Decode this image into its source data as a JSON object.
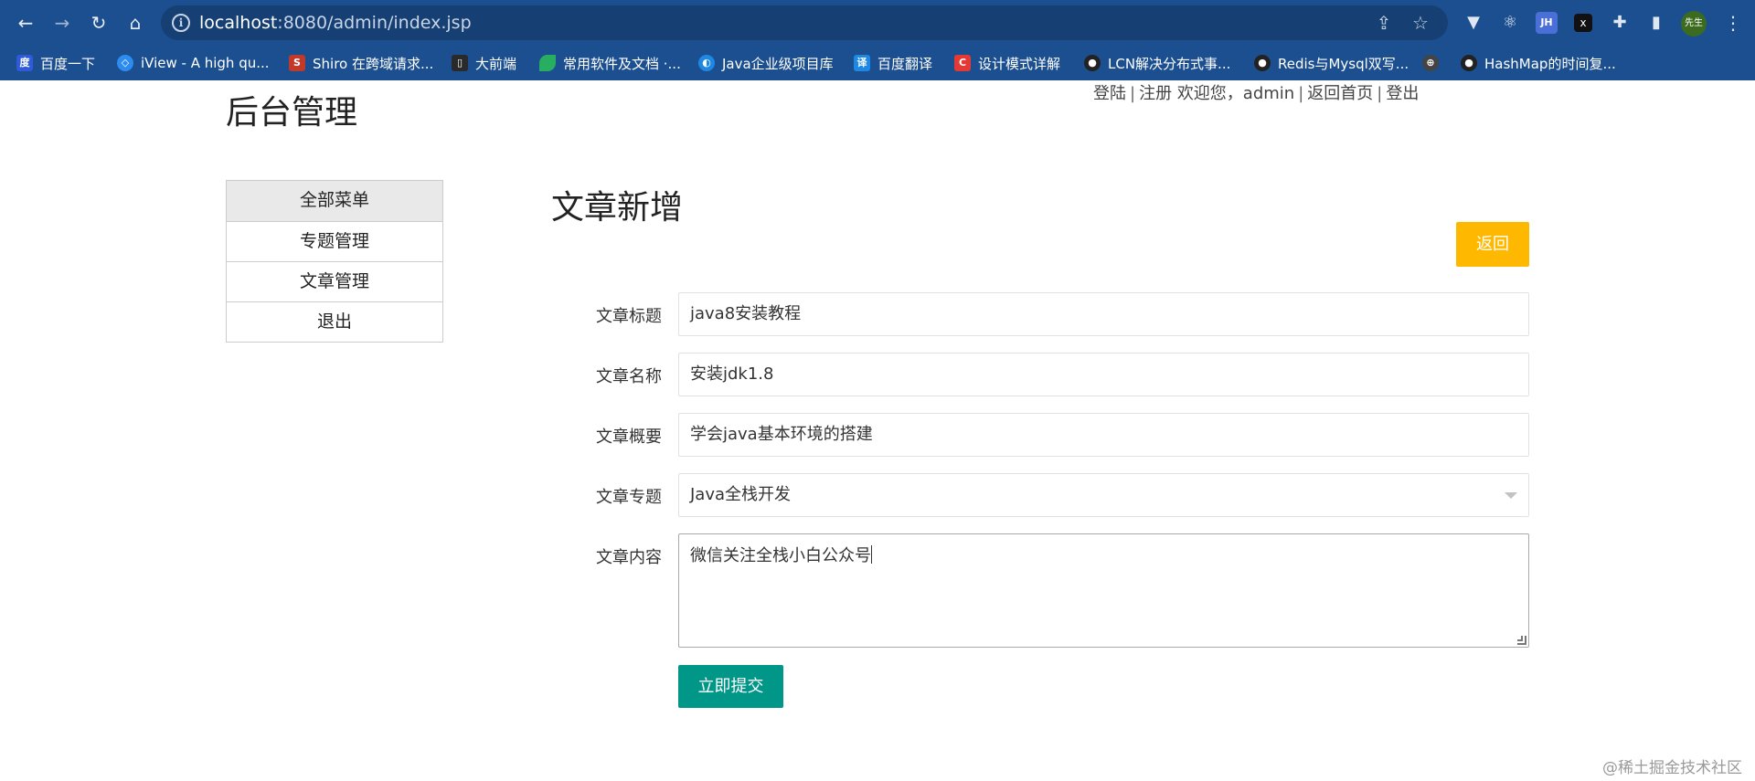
{
  "browser": {
    "url_host": "localhost",
    "url_path": ":8080/admin/index.jsp",
    "profile_label": "先生",
    "bookmarks": [
      {
        "label": "百度一下",
        "icon": "baidu-paw-icon",
        "color": "#2f5bd9"
      },
      {
        "label": "iView - A high qu...",
        "icon": "iview-icon",
        "color": "#2d8cf0"
      },
      {
        "label": "Shiro 在跨域请求...",
        "icon": "shiro-icon",
        "color": "#c0392b"
      },
      {
        "label": "大前端",
        "icon": "book-icon",
        "color": "#2a2a2a"
      },
      {
        "label": "常用软件及文档 ·...",
        "icon": "leaf-icon",
        "color": "#27ae60"
      },
      {
        "label": "Java企业级项目库",
        "icon": "java-lib-icon",
        "color": "#1e88e5"
      },
      {
        "label": "百度翻译",
        "icon": "translate-icon",
        "color": "#1e88e5"
      },
      {
        "label": "设计模式详解",
        "icon": "c-icon",
        "color": "#e53935"
      },
      {
        "label": "LCN解决分布式事...",
        "icon": "github-icon",
        "color": "#222222"
      },
      {
        "label": "Redis与Mysql双写...",
        "icon": "github-icon",
        "color": "#222222"
      },
      {
        "label": "",
        "icon": "globe-icon",
        "color": "#444444"
      },
      {
        "label": "HashMap的时间复...",
        "icon": "github-icon",
        "color": "#222222"
      }
    ]
  },
  "header": {
    "site_title": "后台管理",
    "login": "登陆",
    "register": "注册",
    "welcome": "欢迎您，admin",
    "home": "返回首页",
    "logout": "登出",
    "separator": "|"
  },
  "sidebar": {
    "items": [
      {
        "label": "全部菜单"
      },
      {
        "label": "专题管理"
      },
      {
        "label": "文章管理"
      },
      {
        "label": "退出"
      }
    ]
  },
  "main": {
    "title": "文章新增",
    "back_button": "返回",
    "submit_button": "立即提交",
    "fields": {
      "title": {
        "label": "文章标题",
        "value": "java8安装教程"
      },
      "name": {
        "label": "文章名称",
        "value": "安装jdk1.8"
      },
      "summary": {
        "label": "文章概要",
        "value": "学会java基本环境的搭建"
      },
      "topic": {
        "label": "文章专题",
        "value": "Java全栈开发"
      },
      "content": {
        "label": "文章内容",
        "value": "微信关注全栈小白公众号"
      }
    }
  },
  "watermark": "@稀土掘金技术社区",
  "colors": {
    "chrome": "#1c4f8f",
    "back_button": "#ffb800",
    "submit_button": "#009688"
  }
}
